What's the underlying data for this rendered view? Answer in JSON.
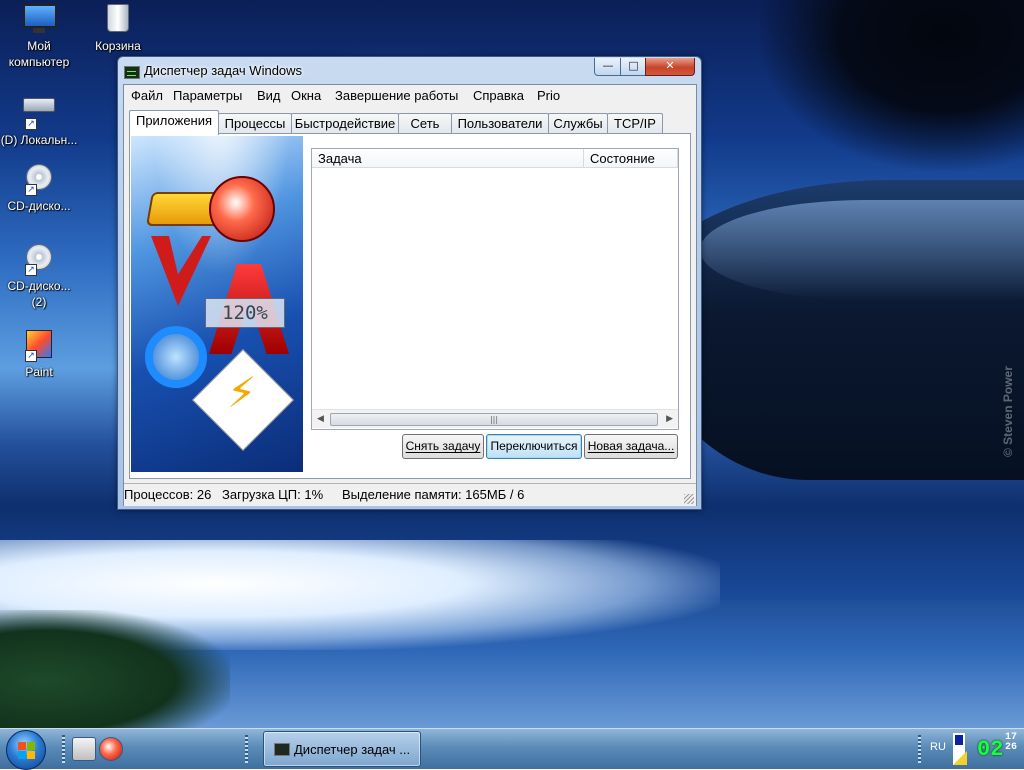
{
  "desktop": {
    "watermark": "© Steven Power",
    "icons": [
      {
        "label": "Мой компьютер"
      },
      {
        "label": "Корзина"
      },
      {
        "label": "(D) Локальн..."
      },
      {
        "label": "CD-диско..."
      },
      {
        "label": "CD-диско... (2)"
      },
      {
        "label": "Paint"
      }
    ]
  },
  "window": {
    "title": "Диспетчер задач Windows",
    "controls": {
      "minimize": "—",
      "maximize": "□",
      "close": "✕"
    },
    "menu": [
      "Файл",
      "Параметры",
      "Вид",
      "Окна",
      "Завершение работы",
      "Справка",
      "Prio"
    ],
    "tabs": [
      "Приложения",
      "Процессы",
      "Быстродействие",
      "Сеть",
      "Пользователи",
      "Службы",
      "TCP/IP"
    ],
    "active_tab": "Приложения",
    "banner": {
      "zoom_text": "120%"
    },
    "task_list": {
      "columns": [
        "Задача",
        "Состояние"
      ],
      "rows": [],
      "scroll_grip": "|||"
    },
    "buttons": {
      "end_task": "Снять задачу",
      "switch_to": "Переключиться",
      "new_task": "Новая задача..."
    },
    "status": {
      "processes": "Процессов: 26",
      "cpu": "Загрузка ЦП: 1%",
      "memory": "Выделение памяти: 165МБ / 6"
    }
  },
  "taskbar": {
    "active_task": "Диспетчер задач ...",
    "language": "RU",
    "clock_hm": "02",
    "clock_s_top": "17",
    "clock_s_bottom": "26"
  },
  "colors": {
    "clock": "#15ff3a",
    "close_button": "#c7452a",
    "taskbar": "#5b8bb8"
  }
}
